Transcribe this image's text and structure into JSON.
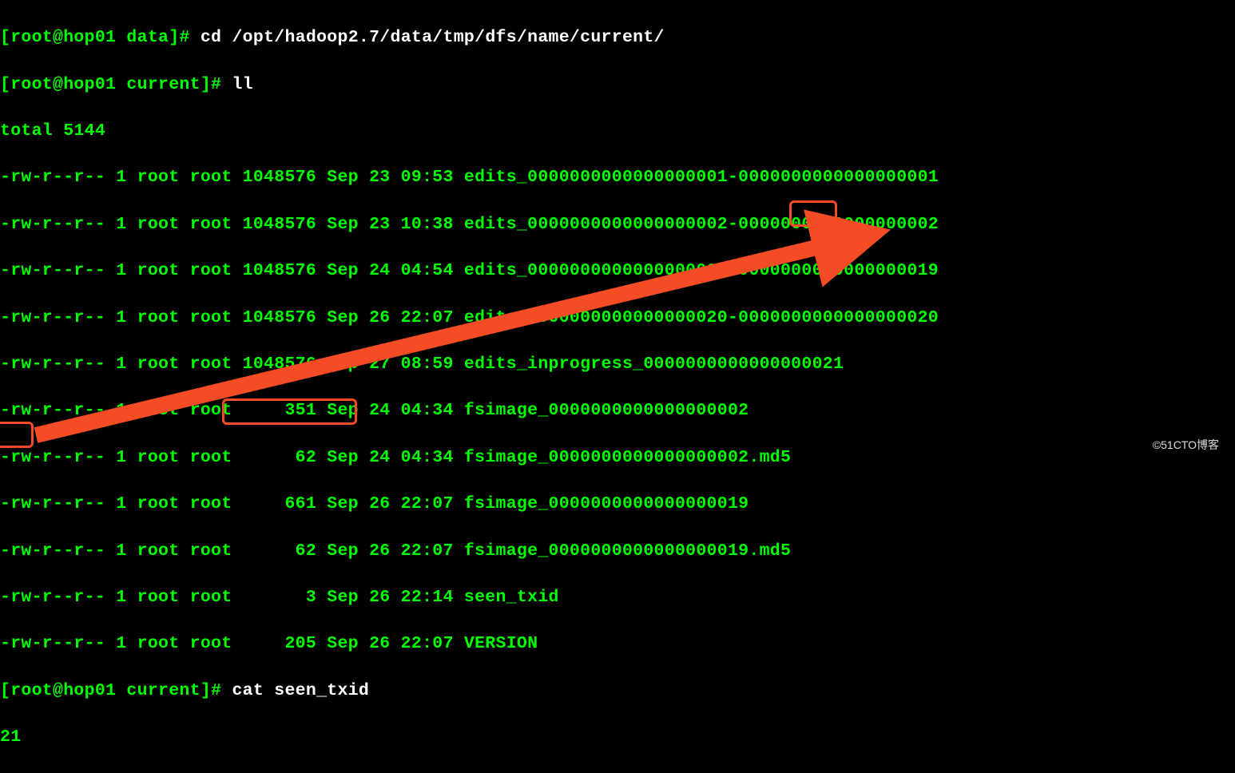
{
  "prompt1": {
    "bracket1": "[",
    "userhost": "root@hop01 data",
    "bracket2": "]# ",
    "cmd": "cd /opt/hadoop2.7/data/tmp/dfs/name/current/"
  },
  "prompt2": {
    "bracket1": "[",
    "userhost": "root@hop01 current",
    "bracket2": "]# ",
    "cmd": "ll"
  },
  "total": "total 5144",
  "listing": [
    {
      "perm": "-rw-r--r-- 1 root root 1048576 Sep 23 09:53 ",
      "file": "edits_0000000000000000001-0000000000000000001"
    },
    {
      "perm": "-rw-r--r-- 1 root root 1048576 Sep 23 10:38 ",
      "file": "edits_0000000000000000002-0000000000000000002"
    },
    {
      "perm": "-rw-r--r-- 1 root root 1048576 Sep 24 04:54 ",
      "file": "edits_0000000000000000003-0000000000000000019"
    },
    {
      "perm": "-rw-r--r-- 1 root root 1048576 Sep 26 22:07 ",
      "file": "edits_0000000000000000020-0000000000000000020"
    },
    {
      "perm": "-rw-r--r-- 1 root root 1048576 Sep 27 08:59 ",
      "file": "edits_inprogress_0000000000000000021"
    },
    {
      "perm": "-rw-r--r-- 1 root root     351 Sep 24 04:34 ",
      "file": "fsimage_0000000000000000002"
    },
    {
      "perm": "-rw-r--r-- 1 root root      62 Sep 24 04:34 ",
      "file": "fsimage_0000000000000000002.md5"
    },
    {
      "perm": "-rw-r--r-- 1 root root     661 Sep 26 22:07 ",
      "file": "fsimage_0000000000000000019"
    },
    {
      "perm": "-rw-r--r-- 1 root root      62 Sep 26 22:07 ",
      "file": "fsimage_0000000000000000019.md5"
    },
    {
      "perm": "-rw-r--r-- 1 root root       3 Sep 26 22:14 ",
      "file": "seen_txid"
    },
    {
      "perm": "-rw-r--r-- 1 root root     205 Sep 26 22:07 ",
      "file": "VERSION"
    }
  ],
  "prompt3": {
    "bracket1": "[",
    "userhost": "root@hop01 current",
    "bracket2": "]# ",
    "cmd": "cat seen_txid"
  },
  "output": "21",
  "watermark": "©51CTO博客"
}
